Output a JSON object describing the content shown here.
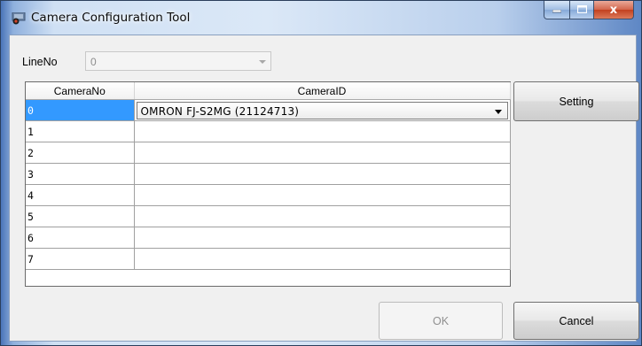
{
  "window": {
    "title": "Camera Configuration Tool",
    "title_icon": "camera-app-icon",
    "caption_buttons": [
      "minimize-icon",
      "maximize-icon",
      "close-icon"
    ],
    "close_glyph": "x"
  },
  "line": {
    "label": "LineNo",
    "value": "0"
  },
  "grid": {
    "columns": [
      "CameraNo",
      "CameraID"
    ],
    "rows": [
      {
        "no": "0",
        "id": "OMRON FJ-S2MG (21124713)"
      },
      {
        "no": "1",
        "id": ""
      },
      {
        "no": "2",
        "id": ""
      },
      {
        "no": "3",
        "id": ""
      },
      {
        "no": "4",
        "id": ""
      },
      {
        "no": "5",
        "id": ""
      },
      {
        "no": "6",
        "id": ""
      },
      {
        "no": "7",
        "id": ""
      }
    ]
  },
  "buttons": {
    "setting": "Setting",
    "ok": "OK",
    "cancel": "Cancel"
  },
  "colors": {
    "selection": "#3399ff",
    "close_button": "#c2401f"
  }
}
